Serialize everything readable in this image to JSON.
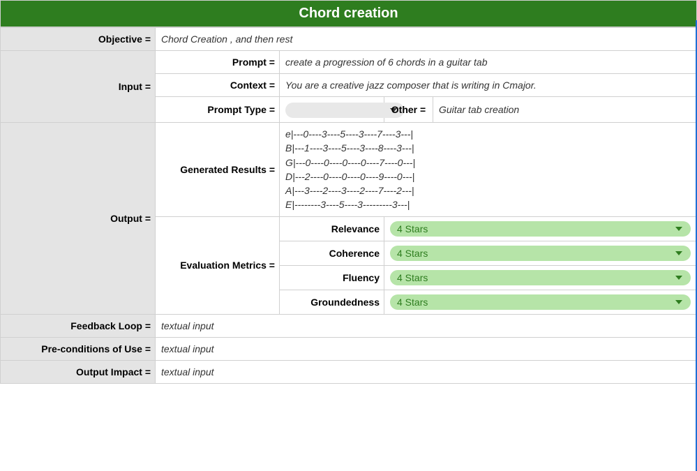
{
  "title": "Chord creation",
  "objective": {
    "label": "Objective =",
    "value": "Chord Creation , and then rest"
  },
  "input": {
    "label": "Input =",
    "prompt": {
      "label": "Prompt =",
      "value": "create a progression of 6 chords in a guitar tab"
    },
    "context": {
      "label": "Context =",
      "value": "You are a creative jazz composer that is writing in Cmajor."
    },
    "prompt_type": {
      "label": "Prompt Type =",
      "selected": ""
    },
    "other": {
      "label": "Other =",
      "value": "Guitar tab creation"
    }
  },
  "output": {
    "label": "Output =",
    "generated": {
      "label": "Generated Results =",
      "lines": [
        "e|---0----3----5----3----7----3---|",
        "B|---1----3----5----3----8----3---|",
        "G|---0----0----0----0----7----0---|",
        "D|---2----0----0----0----9----0---|",
        "A|---3----2----3----2----7----2---|",
        "E|--------3----5----3---------3---|"
      ]
    },
    "metrics": {
      "label": "Evaluation Metrics =",
      "items": [
        {
          "name": "Relevance",
          "value": "4 Stars"
        },
        {
          "name": "Coherence",
          "value": "4 Stars"
        },
        {
          "name": "Fluency",
          "value": "4 Stars"
        },
        {
          "name": "Groundedness",
          "value": "4 Stars"
        }
      ]
    }
  },
  "feedback": {
    "label": "Feedback Loop =",
    "value": "textual input"
  },
  "preconditions": {
    "label": "Pre-conditions of Use =",
    "value": "textual input"
  },
  "impact": {
    "label": "Output Impact =",
    "value": "textual input"
  }
}
